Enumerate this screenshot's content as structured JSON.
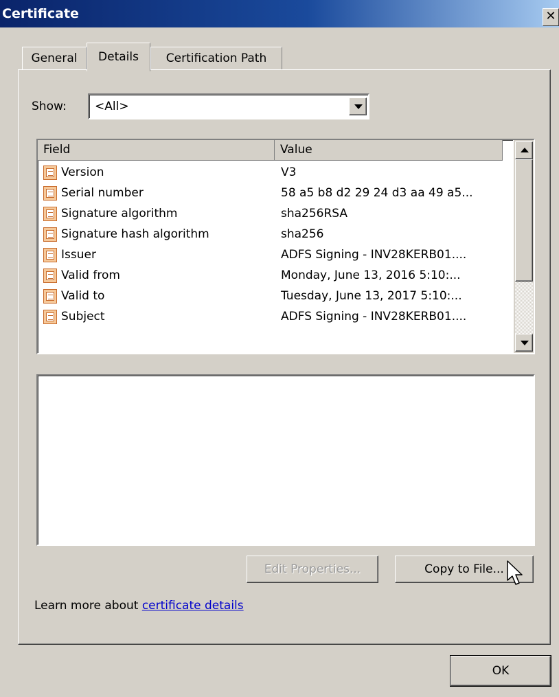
{
  "window": {
    "title": "Certificate",
    "close_glyph": "✕"
  },
  "tabs": [
    {
      "label": "General",
      "active": false
    },
    {
      "label": "Details",
      "active": true
    },
    {
      "label": "Certification Path",
      "active": false
    }
  ],
  "show": {
    "label": "Show:",
    "selected": "<All>"
  },
  "fields_table": {
    "columns": [
      "Field",
      "Value"
    ],
    "rows": [
      {
        "field": "Version",
        "value": "V3"
      },
      {
        "field": "Serial number",
        "value": "58 a5 b8 d2 29 24 d3 aa 49 a5..."
      },
      {
        "field": "Signature algorithm",
        "value": "sha256RSA"
      },
      {
        "field": "Signature hash algorithm",
        "value": "sha256"
      },
      {
        "field": "Issuer",
        "value": "ADFS Signing - INV28KERB01...."
      },
      {
        "field": "Valid from",
        "value": "Monday, June 13, 2016 5:10:..."
      },
      {
        "field": "Valid to",
        "value": "Tuesday, June 13, 2017 5:10:..."
      },
      {
        "field": "Subject",
        "value": "ADFS Signing - INV28KERB01...."
      }
    ]
  },
  "details_text": "",
  "buttons": {
    "edit_properties": "Edit Properties...",
    "copy_to_file": "Copy to File...",
    "ok": "OK"
  },
  "learn_more": {
    "prefix": "Learn more about ",
    "link": "certificate details"
  },
  "icons": {
    "field_row_icon": "certificate-field-icon",
    "cursor": "mouse-pointer-icon"
  },
  "colors": {
    "title_bar": "#0a246a",
    "face": "#d4d0c8",
    "link": "#0000cc"
  }
}
